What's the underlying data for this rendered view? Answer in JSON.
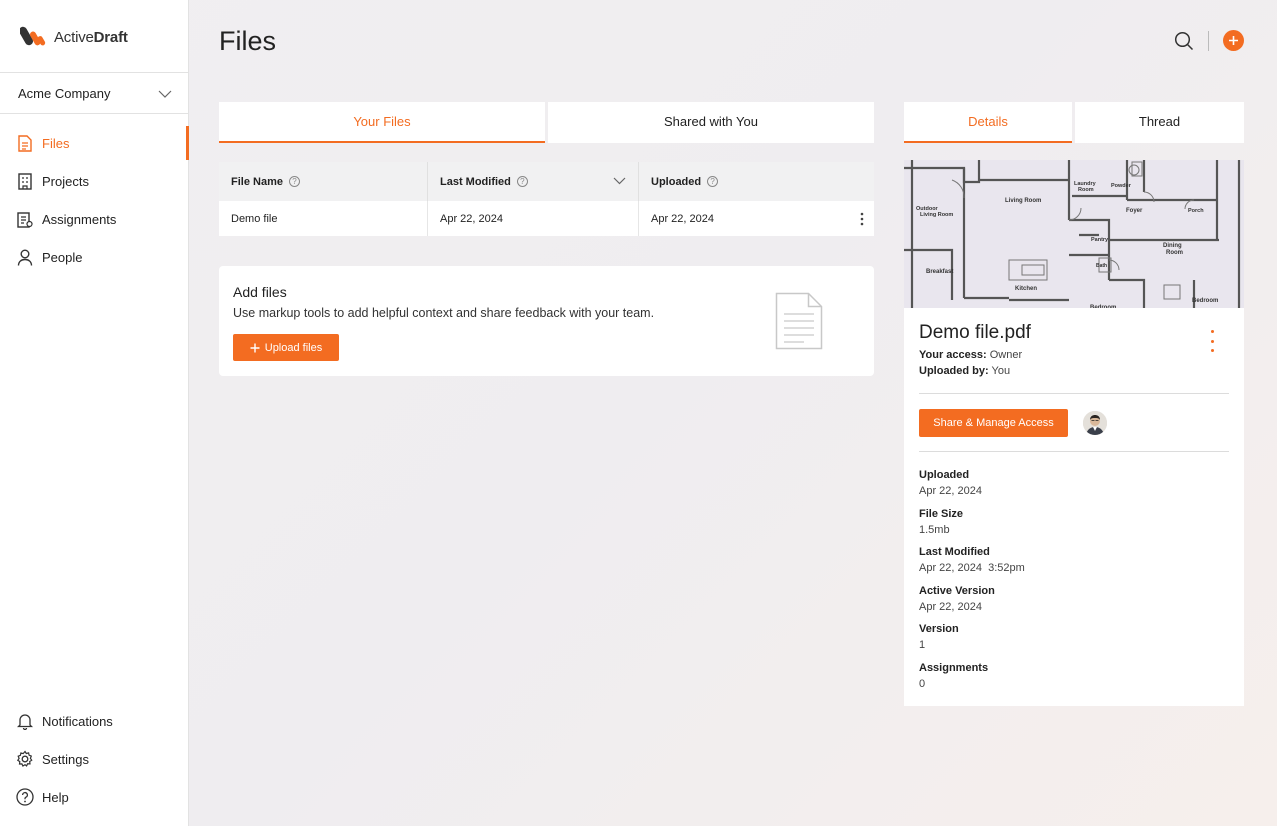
{
  "app": {
    "logo_text_light": "Active",
    "logo_text_bold": "Draft",
    "brand_color": "#f36c21"
  },
  "sidebar": {
    "company": "Acme Company",
    "items": [
      {
        "label": "Files",
        "icon": "file-icon",
        "active": true
      },
      {
        "label": "Projects",
        "icon": "building-icon"
      },
      {
        "label": "Assignments",
        "icon": "clipboard-icon"
      },
      {
        "label": "People",
        "icon": "person-icon"
      }
    ],
    "bottom_items": [
      {
        "label": "Notifications",
        "icon": "bell-icon"
      },
      {
        "label": "Settings",
        "icon": "gear-icon"
      },
      {
        "label": "Help",
        "icon": "help-icon"
      }
    ]
  },
  "header": {
    "title": "Files"
  },
  "file_tabs": [
    {
      "label": "Your Files",
      "active": true
    },
    {
      "label": "Shared with You",
      "active": false
    }
  ],
  "table": {
    "columns": [
      "File Name",
      "Last Modified",
      "Uploaded"
    ],
    "rows": [
      {
        "name": "Demo file",
        "modified": "Apr 22, 2024",
        "uploaded": "Apr 22, 2024"
      }
    ]
  },
  "add_files": {
    "title": "Add files",
    "description": "Use markup tools to add helpful context and share feedback with your team.",
    "button": "Upload files"
  },
  "detail_tabs": [
    {
      "label": "Details",
      "active": true
    },
    {
      "label": "Thread",
      "active": false
    }
  ],
  "floorplan": {
    "rooms": [
      "Laundry Room",
      "Powder",
      "Living Room",
      "Outdoor Living Room",
      "Foyer",
      "Porch",
      "Pantry",
      "Dining Room",
      "Bath",
      "Breakfast",
      "Kitchen",
      "Bedroom",
      "Bedroom"
    ]
  },
  "details": {
    "file_name": "Demo file.pdf",
    "access_label": "Your access:",
    "access_value": "Owner",
    "uploaded_by_label": "Uploaded by:",
    "uploaded_by_value": "You",
    "share_button": "Share & Manage Access",
    "info": [
      {
        "label": "Uploaded",
        "value": "Apr 22, 2024"
      },
      {
        "label": "File Size",
        "value": "1.5mb"
      },
      {
        "label": "Last Modified",
        "value": "Apr 22, 2024  3:52pm"
      },
      {
        "label": "Active Version",
        "value": "Apr 22, 2024"
      },
      {
        "label": "Version",
        "value": "1"
      },
      {
        "label": "Assignments",
        "value": "0"
      }
    ]
  }
}
